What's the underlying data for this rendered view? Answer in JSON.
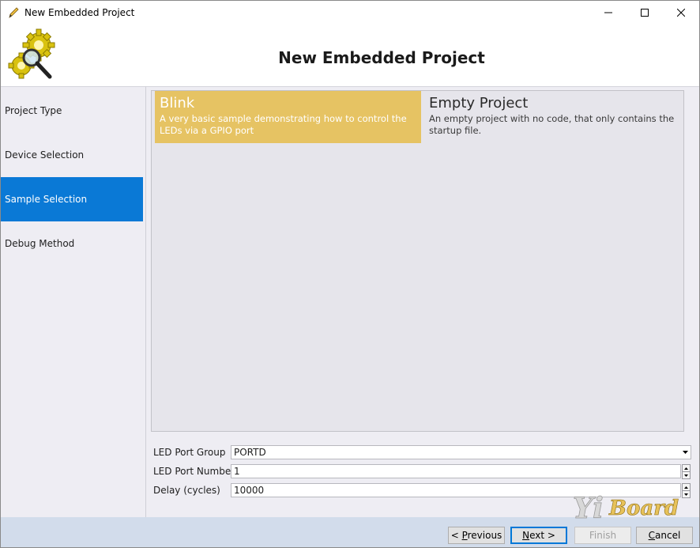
{
  "window": {
    "title": "New Embedded Project",
    "controls": {
      "minimize_icon": "minimize-icon",
      "maximize_icon": "maximize-icon",
      "close_icon": "close-icon"
    }
  },
  "header": {
    "title": "New Embedded Project",
    "logo_icon": "gears-magnifier-icon"
  },
  "sidebar": {
    "items": [
      {
        "label": "Project Type",
        "active": false
      },
      {
        "label": "Device Selection",
        "active": false
      },
      {
        "label": "Sample Selection",
        "active": true
      },
      {
        "label": "Debug Method",
        "active": false
      }
    ]
  },
  "samples": [
    {
      "title": "Blink",
      "description": "A very basic sample demonstrating how to control the LEDs via a GPIO port",
      "selected": true
    },
    {
      "title": "Empty Project",
      "description": "An empty project with no code, that only contains the startup file.",
      "selected": false
    }
  ],
  "properties": [
    {
      "label": "LED Port Group",
      "value": "PORTD",
      "control": "dropdown"
    },
    {
      "label": "LED Port Number",
      "value": "1",
      "control": "spinner"
    },
    {
      "label": "Delay (cycles)",
      "value": "10000",
      "control": "spinner"
    }
  ],
  "footer": {
    "previous_label": "< Previous",
    "next_label": "Next >",
    "finish_label": "Finish",
    "cancel_label": "Cancel"
  },
  "watermark": {
    "text": "YiBoard"
  },
  "colors": {
    "accent": "#0a79d6",
    "selected_sample": "#e6c363",
    "footer_bg": "#d2dceb",
    "panel_bg": "#eeedf3"
  }
}
